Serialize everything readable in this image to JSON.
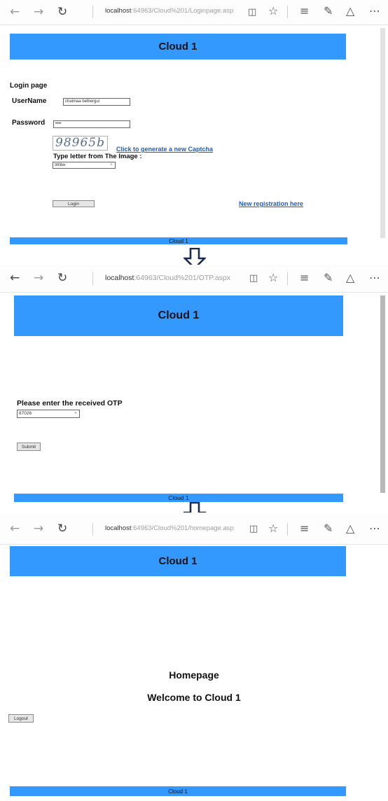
{
  "browser": {
    "back_icon": "arrow-left-icon",
    "forward_icon": "arrow-right-icon",
    "refresh_icon": "refresh-icon",
    "reading_view_icon": "book-icon",
    "favorite_icon": "star-icon",
    "hub_icon": "hub-icon",
    "note_icon": "pen-note-icon",
    "share_icon": "share-icon",
    "more_icon": "ellipsis-icon"
  },
  "login": {
    "url_host": "localhost",
    "url_path": ":64963/Cloud%201/Loginpage.asp",
    "banner": "Cloud 1",
    "page_title": "Login page",
    "username_label": "UserName",
    "username_value": "chaimaa belbergui",
    "password_label": "Password",
    "password_value": "••••",
    "captcha_text": "98965b",
    "captcha_link": "Click to generate a new Captcha",
    "captcha_prompt": "Type letter from The Image :",
    "captcha_value": "989bb",
    "login_button": "Login",
    "registration_link": "New registration here",
    "footer": "Cloud 1"
  },
  "otp": {
    "url_host": "localhost",
    "url_path": ":64963/Cloud%201/OTP.aspx",
    "banner": "Cloud 1",
    "prompt": "Please enter the received OTP",
    "otp_value": "87026",
    "submit_button": "Submit",
    "footer": "Cloud 1"
  },
  "home": {
    "url_host": "localhost",
    "url_path": ":64963/Cloud%201/homepage.asp",
    "banner": "Cloud 1",
    "heading": "Homepage",
    "welcome": "Welcome to Cloud 1",
    "logout_button": "Logout",
    "footer": "Cloud 1"
  },
  "colors": {
    "banner": "#3399ff",
    "link": "#1a5fc8"
  }
}
